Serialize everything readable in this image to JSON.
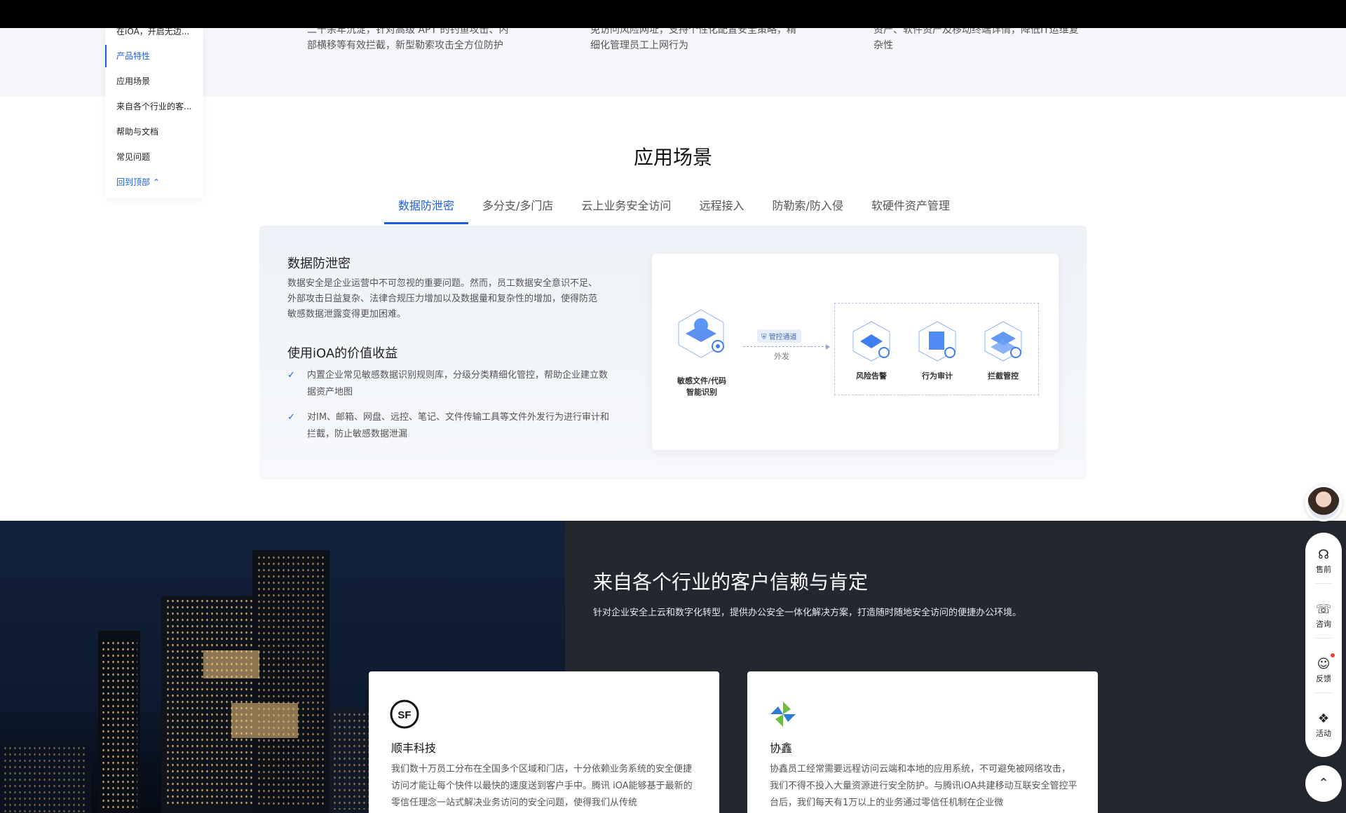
{
  "features": [
    {
      "text": "二十余年沉淀，针对高级 APT 的钓鱼攻击、内部横移等有效拦截，新型勒索攻击全方位防护"
    },
    {
      "text": "免访问风险网址，支持个性化配置安全策略，精细化管理员工上网行为"
    },
    {
      "text": "资产、软件资产及移动终端详情，降低IT运维复杂性"
    }
  ],
  "side_nav": {
    "items": [
      {
        "label": "在iOA，开启无边..."
      },
      {
        "label": "产品特性"
      },
      {
        "label": "应用场景"
      },
      {
        "label": "来自各个行业的客..."
      },
      {
        "label": "帮助与文档"
      },
      {
        "label": "常见问题"
      }
    ],
    "back_to_top": "回到顶部"
  },
  "scenarios": {
    "title": "应用场景",
    "tabs": [
      {
        "label": "数据防泄密"
      },
      {
        "label": "多分支/多门店"
      },
      {
        "label": "云上业务安全访问"
      },
      {
        "label": "远程接入"
      },
      {
        "label": "防勒索/防入侵"
      },
      {
        "label": "软硬件资产管理"
      }
    ],
    "panel": {
      "heading": "数据防泄密",
      "description": "数据安全是企业运营中不可忽视的重要问题。然而，员工数据安全意识不足、外部攻击日益复杂、法律合规压力增加以及数据量和复杂性的增加，使得防范敏感数据泄露变得更加困难。",
      "benefits_title": "使用iOA的价值收益",
      "benefits": [
        {
          "text": "内置企业常见敏感数据识别规则库，分级分类精细化管控，帮助企业建立数据资产地图"
        },
        {
          "text": "对IM、邮箱、网盘、远控、笔记、文件传输工具等文件外发行为进行审计和拦截，防止敏感数据泄漏"
        }
      ],
      "diagram": {
        "source_label": "敏感文件/代码\n智能识别",
        "channel_label": "管控通道",
        "arrow_label": "外发",
        "nodes": [
          {
            "label": "风险告警"
          },
          {
            "label": "行为审计"
          },
          {
            "label": "拦截管控"
          }
        ]
      }
    }
  },
  "customers": {
    "title": "来自各个行业的客户信赖与肯定",
    "subtitle": "针对企业安全上云和数字化转型，提供办公安全一体化解决方案，打造随时随地安全访问的便捷办公环境。",
    "cards": [
      {
        "name": "顺丰科技",
        "logo_text": "SF",
        "text": "我们数十万员工分布在全国多个区域和门店，十分依赖业务系统的安全便捷访问才能让每个快件以最快的速度送到客户手中。腾讯 iOA能够基于最新的零信任理念一站式解决业务访问的安全问题，使得我们从传统"
      },
      {
        "name": "协鑫",
        "text": "协鑫员工经常需要远程访问云端和本地的应用系统，不可避免被网络攻击，我们不得不投入大量资源进行安全防护。与腾讯iOA共建移动互联安全管控平台后，我们每天有1万以上的业务通过零信任机制在企业微"
      }
    ]
  },
  "float_bar": {
    "items": [
      {
        "label": "售前",
        "icon": "headset-icon"
      },
      {
        "label": "咨询",
        "icon": "chat-icon"
      },
      {
        "label": "反馈",
        "icon": "smile-icon"
      },
      {
        "label": "活动",
        "icon": "gift-icon"
      }
    ]
  },
  "colors": {
    "accent": "#1f5fd6",
    "dark_bg": "#232730",
    "alert_dot": "#f04438"
  }
}
